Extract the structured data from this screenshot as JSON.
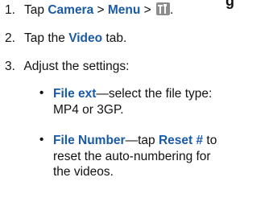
{
  "heading_partial": "g",
  "steps": [
    {
      "number": "1.",
      "prefix": "Tap ",
      "item1": "Camera",
      "sep1": " > ",
      "item2": "Menu",
      "sep2": " > ",
      "icon": "tools-icon",
      "suffix": "."
    },
    {
      "number": "2.",
      "prefix": "Tap the ",
      "keyword": "Video",
      "suffix": " tab."
    },
    {
      "number": "3.",
      "text": "Adjust the settings:"
    }
  ],
  "bullets": [
    {
      "keyword": "File ext",
      "line1_rest": "—select the file type:",
      "line2": "MP4 or 3GP."
    },
    {
      "keyword": "File Number",
      "line1_mid": "—tap ",
      "keyword2": "Reset #",
      "line1_rest": " to",
      "line2": "reset the auto-numbering for",
      "line3": "the videos."
    }
  ],
  "colors": {
    "keyword": "#1a5aa6",
    "text": "#111111",
    "icon_bg": "#8c8c8c"
  }
}
